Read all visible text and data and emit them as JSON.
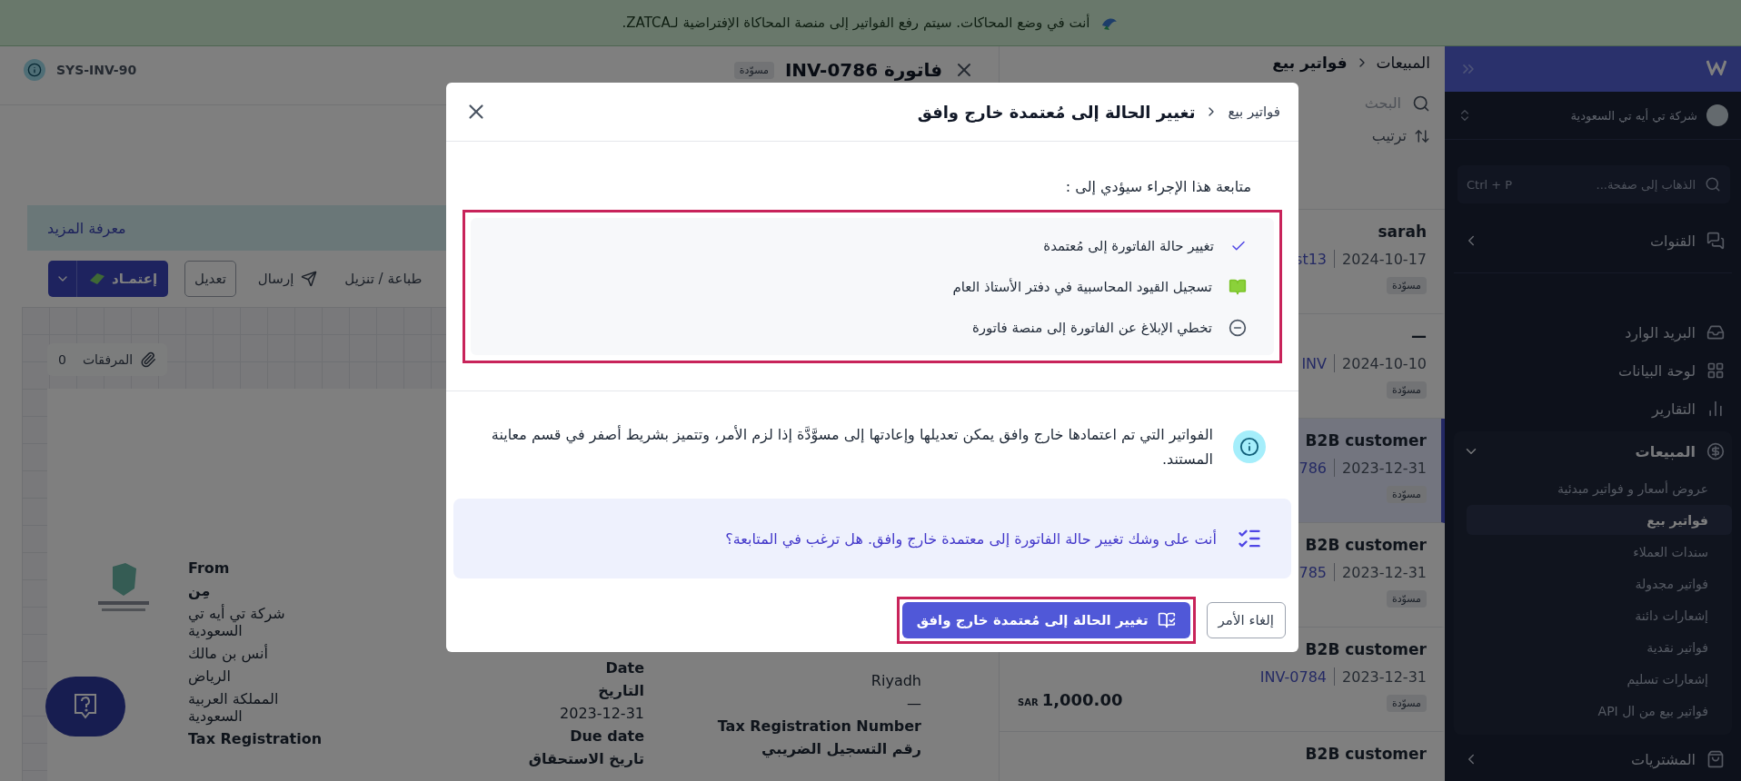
{
  "banner": {
    "text": "أنت في وضع المحاكات. سيتم رفع الفواتير إلى منصة المحاكاة الإفتراضية لـZATCA."
  },
  "sidebar": {
    "company": "شركة تي أيه تي السعودية",
    "search": {
      "placeholder": "الذهاب إلى صفحة...",
      "shortcut": "Ctrl + P"
    },
    "items": [
      {
        "label": "القنوات",
        "expanded": false
      },
      {
        "label": "البريد الوارد"
      },
      {
        "label": "لوحة البيانات"
      },
      {
        "label": "التقارير"
      },
      {
        "label": "المبيعات",
        "expanded": true,
        "children": [
          {
            "label": "عروض أسعار و فواتير مبدئية",
            "selected": false
          },
          {
            "label": "فواتير بيع",
            "selected": true
          },
          {
            "label": "سندات العملاء",
            "selected": false
          },
          {
            "label": "فواتير مجدولة",
            "selected": false
          },
          {
            "label": "إشعارات دائنة",
            "selected": false
          },
          {
            "label": "فواتير نقدية",
            "selected": false
          },
          {
            "label": "إشعارات تسليم",
            "selected": false
          },
          {
            "label": "فواتير بيع من ال API",
            "selected": false
          }
        ]
      },
      {
        "label": "المشتريات",
        "expanded": false
      }
    ]
  },
  "list": {
    "breadcrumb": [
      "المبيعات",
      "فواتير بيع"
    ],
    "search_placeholder": "البحث",
    "sort": "ترتيب",
    "rows": [
      {
        "name": "sarah",
        "number": "st13",
        "date": "2024-10-17",
        "status": "مسوّدة",
        "selected": false
      },
      {
        "name": "—",
        "number": "INV",
        "date": "2024-10-10",
        "status": "مسوّدة",
        "selected": false
      },
      {
        "name": "B2B customer",
        "number": "786",
        "date": "2023-12-31",
        "status": "مسوّدة",
        "selected": true
      },
      {
        "name": "B2B customer",
        "number": "785",
        "date": "2023-12-31",
        "status": "مسوّدة",
        "selected": false
      },
      {
        "name": "B2B customer",
        "number": "INV-0784",
        "date": "2023-12-31",
        "status": "مسوّدة",
        "currency": "SAR",
        "amount": "1,000.00",
        "selected": false
      },
      {
        "name": "B2B customer",
        "selected": false
      }
    ]
  },
  "detail": {
    "title": "فاتورة INV-0786",
    "status": "مسوّدة",
    "system_id": "SYS-INV-90",
    "learn_more": "معرفة المزيد",
    "toolbar": {
      "approve": "إعتمـاد",
      "edit": "تعديل",
      "send": "إرسال",
      "print": "طباعة / تنزيل"
    },
    "attachments": {
      "label": "المرفقات",
      "count": "0"
    },
    "invoice": {
      "from": [
        "From",
        "مِن",
        "شركة تي أيه تي السعودية",
        "أنس بن مالك",
        "الرياض",
        "المملكة العربية السعودية",
        "Tax Registration"
      ],
      "dates": [
        "Date",
        "التاريخ",
        "2023-12-31",
        "Due date",
        "تاريخ الاستحقاق"
      ],
      "seller": [
        "Riyadh",
        "—",
        "Tax Registration Number",
        "رقم التسجيل الضريبي"
      ]
    }
  },
  "modal": {
    "breadcrumb": "فواتير بيع",
    "title": "تغيير الحالة إلى مُعتمدة خارج وافق",
    "intro": "متابعة هذا الإجراء سيؤدي إلى :",
    "effects_highlighted": true,
    "effects": [
      {
        "kind": "check",
        "text": "تغيير حالة الفاتورة إلى مُعتمدة"
      },
      {
        "kind": "ledger",
        "text": "تسجيل القيود المحاسبية في دفتر الأستاذ العام"
      },
      {
        "kind": "skip",
        "text": "تخطي الإبلاغ عن الفاتورة إلى منصة فاتورة"
      }
    ],
    "note": "الفواتير التي تم اعتمادها خارج وافق يمكن تعديلها وإعادتها إلى مسوَّدَّة إذا لزم الأمر، وتتميز بشريط أصفر في قسم معاينة المستند.",
    "prompt": "أنت على وشك تغيير حالة الفاتورة إلى معتمدة خارج وافق. هل ترغب في المتابعة؟",
    "confirm": "تغيير الحالة إلى مُعتمدة خارج وافق",
    "confirm_highlighted": true,
    "cancel": "إلغاء الأمر"
  }
}
